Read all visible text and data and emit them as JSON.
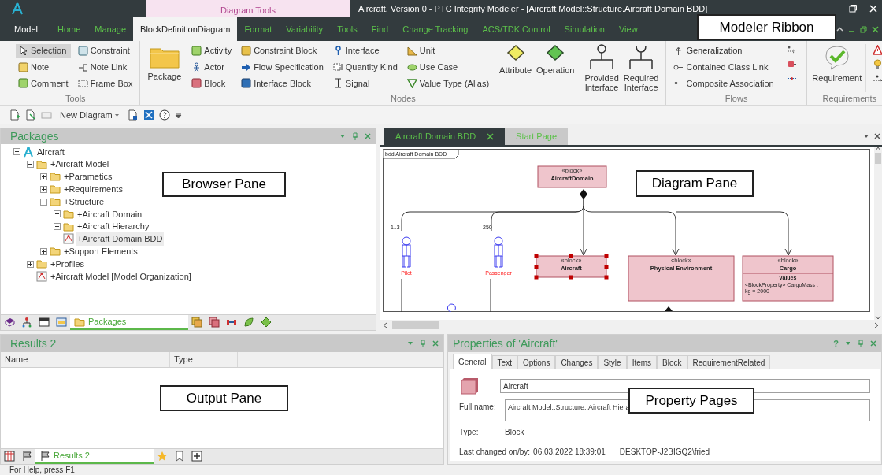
{
  "window": {
    "title": "Aircraft, Version 0 - PTC Integrity Modeler - [Aircraft Model::Structure.Aircraft Domain BDD]",
    "context_tab": "Diagram Tools"
  },
  "ribbon_tabs": [
    {
      "label": "Model",
      "selected": false,
      "kind": "file"
    },
    {
      "label": "Home",
      "selected": false,
      "kind": "normal"
    },
    {
      "label": "Manage",
      "selected": false,
      "kind": "normal"
    },
    {
      "label": "BlockDefinitionDiagram",
      "selected": true,
      "kind": "normal"
    },
    {
      "label": "Format",
      "selected": false,
      "kind": "normal"
    },
    {
      "label": "Variability",
      "selected": false,
      "kind": "normal"
    },
    {
      "label": "Tools",
      "selected": false,
      "kind": "normal"
    },
    {
      "label": "Find",
      "selected": false,
      "kind": "normal"
    },
    {
      "label": "Change Tracking",
      "selected": false,
      "kind": "normal"
    },
    {
      "label": "ACS/TDK Control",
      "selected": false,
      "kind": "normal"
    },
    {
      "label": "Simulation",
      "selected": false,
      "kind": "normal"
    },
    {
      "label": "View",
      "selected": false,
      "kind": "normal"
    }
  ],
  "ribbon_groups": [
    {
      "label": "Tools",
      "sections": [
        {
          "kind": "grid",
          "items": [
            {
              "label": "Selection",
              "selected": true
            },
            {
              "label": "Note",
              "selected": false
            },
            {
              "label": "Comment",
              "selected": false
            },
            {
              "label": "Constraint",
              "selected": false
            },
            {
              "label": "Note Link",
              "selected": false
            },
            {
              "label": "Frame Box",
              "selected": false
            }
          ]
        }
      ]
    },
    {
      "label": "Nodes",
      "sections": [
        {
          "kind": "large",
          "items": [
            {
              "label": "Package"
            }
          ]
        },
        {
          "kind": "grid",
          "items": [
            {
              "label": "Activity"
            },
            {
              "label": "Actor"
            },
            {
              "label": "Block"
            },
            {
              "label": "Constraint Block"
            },
            {
              "label": "Flow Specification"
            },
            {
              "label": "Interface Block"
            },
            {
              "label": "Interface"
            },
            {
              "label": "Quantity Kind"
            },
            {
              "label": "Signal"
            },
            {
              "label": "Unit"
            },
            {
              "label": "Use Case"
            },
            {
              "label": "Value Type (Alias)"
            }
          ]
        },
        {
          "kind": "large",
          "items": [
            {
              "label": "Attribute"
            },
            {
              "label": "Operation"
            }
          ]
        },
        {
          "kind": "large",
          "items": [
            {
              "label": "Provided Interface"
            },
            {
              "label": "Required Interface"
            }
          ]
        }
      ]
    },
    {
      "label": "Flows",
      "sections": [
        {
          "kind": "grid",
          "items": [
            {
              "label": "Generalization"
            },
            {
              "label": "Contained Class Link"
            },
            {
              "label": "Composite Association"
            }
          ]
        },
        {
          "kind": "icons"
        }
      ]
    },
    {
      "label": "Requirements",
      "sections": [
        {
          "kind": "large",
          "items": [
            {
              "label": "Requirement"
            }
          ]
        },
        {
          "kind": "icons"
        }
      ]
    }
  ],
  "quick_toolbar": {
    "new_diagram": "New Diagram"
  },
  "browser": {
    "title": "Packages",
    "tree": [
      {
        "label": "Aircraft",
        "kind": "model",
        "expanded": true,
        "selected": false,
        "children": [
          {
            "label": "+Aircraft Model",
            "kind": "package",
            "expanded": true,
            "selected": false,
            "children": [
              {
                "label": "+Parametics",
                "kind": "package",
                "expanded": false,
                "selected": false
              },
              {
                "label": "+Requirements",
                "kind": "package",
                "expanded": false,
                "selected": false
              },
              {
                "label": "+Structure",
                "kind": "package",
                "expanded": true,
                "selected": false,
                "children": [
                  {
                    "label": "+Aircraft Domain",
                    "kind": "package",
                    "expanded": false,
                    "selected": false
                  },
                  {
                    "label": "+Aircraft Hierarchy",
                    "kind": "package",
                    "expanded": false,
                    "selected": false
                  },
                  {
                    "label": "+Aircraft Domain BDD",
                    "kind": "diagram",
                    "selected": true
                  }
                ]
              },
              {
                "label": "+Support Elements",
                "kind": "package",
                "expanded": false,
                "selected": false
              }
            ]
          },
          {
            "label": "+Profiles",
            "kind": "package",
            "expanded": false,
            "selected": false
          },
          {
            "label": "+Aircraft Model [Model Organization]",
            "kind": "diagram",
            "selected": false
          }
        ]
      }
    ],
    "bottom_tabs": [
      {
        "kind": "icon",
        "selected": false
      },
      {
        "kind": "icon",
        "selected": false
      },
      {
        "kind": "icon",
        "selected": false
      },
      {
        "kind": "icon",
        "selected": false
      },
      {
        "kind": "text",
        "label": "Packages",
        "selected": true
      },
      {
        "kind": "icon",
        "selected": false
      },
      {
        "kind": "icon",
        "selected": false
      },
      {
        "kind": "icon",
        "selected": false
      },
      {
        "kind": "icon",
        "selected": false
      },
      {
        "kind": "icon",
        "selected": false
      }
    ]
  },
  "diagram": {
    "tabs": [
      {
        "label": "Aircraft Domain BDD",
        "selected": true
      },
      {
        "label": "Start Page",
        "selected": false
      }
    ],
    "frame_label": "bdd Aircraft Domain BDD",
    "blocks": [
      {
        "stereotype": "«block»",
        "name": "AircraftDomain",
        "selected": false
      },
      {
        "stereotype": "«block»",
        "name": "Aircraft",
        "selected": true
      },
      {
        "stereotype": "«block»",
        "name": "Physical Environment",
        "selected": false
      },
      {
        "stereotype": "«block»",
        "name": "Cargo",
        "selected": false,
        "compartment": {
          "title": "values",
          "lines": [
            "«BlockProperty» CargoMass :",
            "kg = 2000"
          ]
        }
      }
    ],
    "actors": [
      {
        "name": "Pilot",
        "multiplicity": "1..3"
      },
      {
        "name": "Passenger",
        "multiplicity": "250"
      }
    ]
  },
  "results": {
    "title": "Results 2",
    "columns": [
      "Name",
      "Type"
    ],
    "bottom_tabs": [
      {
        "kind": "icon",
        "selected": false
      },
      {
        "kind": "icon",
        "selected": false
      },
      {
        "kind": "text",
        "label": "Results 2",
        "selected": true
      },
      {
        "kind": "icon",
        "selected": false
      },
      {
        "kind": "icon",
        "selected": false
      },
      {
        "kind": "icon",
        "selected": false
      }
    ]
  },
  "properties": {
    "title": "Properties of 'Aircraft'",
    "help": "?",
    "tabs": [
      {
        "label": "General",
        "selected": true
      },
      {
        "label": "Text",
        "selected": false
      },
      {
        "label": "Options",
        "selected": false
      },
      {
        "label": "Changes",
        "selected": false
      },
      {
        "label": "Style",
        "selected": false
      },
      {
        "label": "Items",
        "selected": false
      },
      {
        "label": "Block",
        "selected": false
      },
      {
        "label": "RequirementRelated",
        "selected": false
      }
    ],
    "name_value": "Aircraft",
    "full_name_label": "Full name:",
    "full_name_value": "Aircraft Model::Structure::Aircraft Hiera",
    "type_label": "Type:",
    "type_value": "Block",
    "last_changed_label": "Last changed on/by:",
    "last_changed_value": "06.03.2022 18:39:01",
    "last_changed_by": "DESKTOP-J2BIGQ2\\fried"
  },
  "status_bar": "For Help, press F1",
  "callouts": [
    {
      "text": "Modeler Ribbon"
    },
    {
      "text": "Browser Pane"
    },
    {
      "text": "Diagram Pane"
    },
    {
      "text": "Output Pane"
    },
    {
      "text": "Property Pages"
    }
  ]
}
